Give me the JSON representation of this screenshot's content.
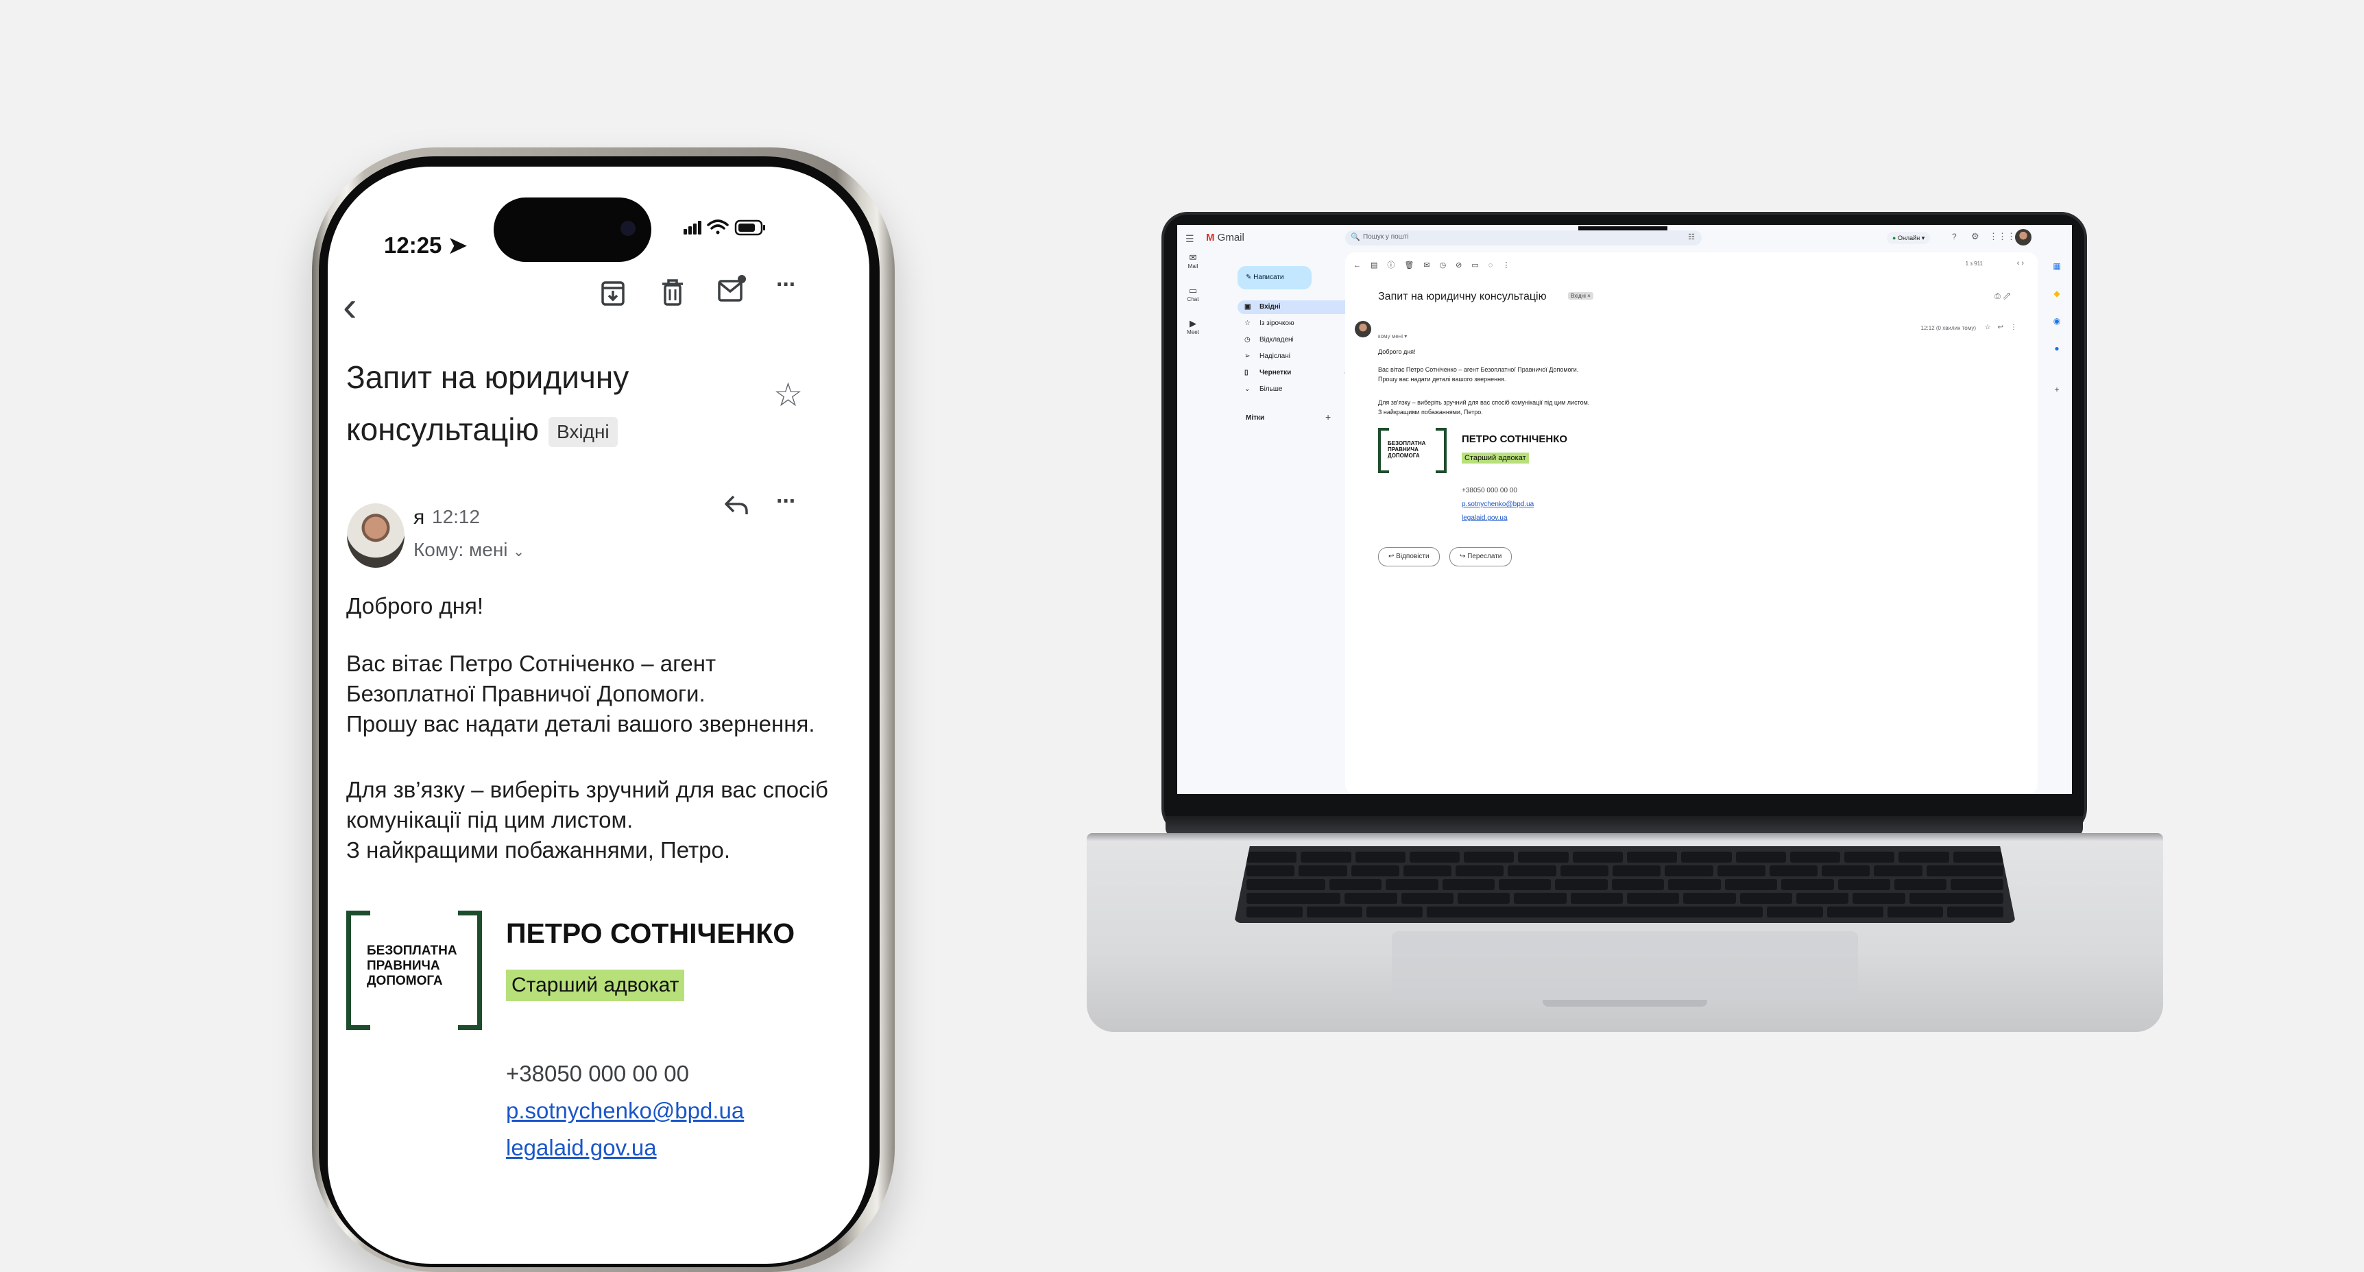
{
  "phone": {
    "status": {
      "time": "12:25"
    },
    "toolbar": {
      "back_label": "‹",
      "more_label": "···"
    },
    "subject": "Запит на юридичну консультацію",
    "label_badge": "Вхідні",
    "message": {
      "sender": "я",
      "time": "12:12",
      "to_line": "Кому: мені",
      "greeting": "Доброго дня!",
      "p1_line1": "Вас вітає Петро Сотніченко – агент",
      "p1_line2": "Безоплатної Правничої Допомоги.",
      "p1_line3": "Прошу вас надати деталі вашого звернення.",
      "p2_line1": "Для зв’язку – виберіть зручний для вас спосіб",
      "p2_line2": "комунікації під цим листом.",
      "p2_line3": "З найкращими побажаннями, Петро."
    },
    "signature": {
      "logo_line1": "БЕЗОПЛАТНА",
      "logo_line2": "ПРАВНИЧА",
      "logo_line3": "ДОПОМОГА",
      "name": "ПЕТРО СОТНІЧЕНКО",
      "role": "Старший адвокат",
      "phone": "+38050 000 00 00",
      "email": "p.sotnychenko@bpd.ua",
      "website": "legalaid.gov.ua"
    }
  },
  "laptop": {
    "gmail": {
      "brand": "Gmail",
      "search_placeholder": "Пошук у пошті",
      "status": "Онлайн",
      "compose_label": "Написати",
      "rail": [
        {
          "label": "Mail"
        },
        {
          "label": "Chat"
        },
        {
          "label": "Meet"
        }
      ],
      "folders": [
        {
          "label": "Вхідні",
          "count": "1"
        },
        {
          "label": "Із зірочкою"
        },
        {
          "label": "Відкладені"
        },
        {
          "label": "Надіслані"
        },
        {
          "label": "Чернетки",
          "count": "4"
        },
        {
          "label": "Більше"
        }
      ],
      "labels_heading": "Мітки",
      "pagination": "1 з 911",
      "subject": "Запит на юридичну консультацію",
      "label_badge": "Вхідні ×",
      "to_line": "кому мені ▾",
      "timestamp": "12:12 (0 хвилин тому)",
      "body": {
        "greeting": "Доброго дня!",
        "p1_line1": "Вас вітає Петро Сотніченко – агент Безоплатної Правничої Допомоги.",
        "p1_line2": "Прошу вас надати деталі вашого звернення.",
        "p2_line1": "Для зв’язку – виберіть зручний для вас спосіб комунікації під цим листом.",
        "p2_line2": "З найкращими побажаннями, Петро."
      },
      "reply_label": "Відповісти",
      "forward_label": "Переслати"
    }
  },
  "colors": {
    "brand_green": "#1d4d2c",
    "role_highlight": "#b8e07a",
    "link_blue": "#1a56c8"
  }
}
